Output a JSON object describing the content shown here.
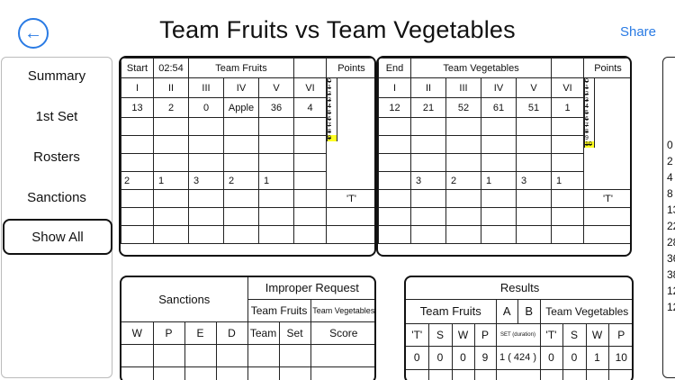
{
  "header": {
    "title": "Team Fruits vs  Team Vegetables",
    "share": "Share",
    "back_icon": "circle-arrow-left-icon"
  },
  "sidebar": {
    "items": [
      "Summary",
      "1st Set",
      "Rosters",
      "Sanctions",
      "Show All"
    ],
    "selected": "Show All"
  },
  "left_team": {
    "label": "Start",
    "time": "02:54",
    "name": "Team Fruits",
    "points_label": "Points",
    "positions": [
      "I",
      "II",
      "III",
      "IV",
      "V",
      "VI"
    ],
    "players": [
      "13",
      "2",
      "0",
      "Apple",
      "36",
      "4"
    ],
    "serve": [
      "2",
      "1",
      "3",
      "2",
      "1",
      ""
    ],
    "points": [
      "0",
      "1",
      "2",
      "3",
      "4",
      "5",
      "6",
      "7",
      "8",
      "9"
    ],
    "current_point": "9"
  },
  "right_team": {
    "label": "End",
    "name": "Team Vegetables",
    "points_label": "Points",
    "positions": [
      "I",
      "II",
      "III",
      "IV",
      "V",
      "VI"
    ],
    "players": [
      "12",
      "21",
      "52",
      "61",
      "51",
      "1"
    ],
    "serve": [
      "3",
      "2",
      "1",
      "3",
      "1",
      ""
    ],
    "points": [
      "0",
      "1",
      "2",
      "3",
      "4",
      "5",
      "6",
      "7",
      "8",
      "9",
      "10"
    ],
    "current_point": "10"
  },
  "timeout_marker": "'T'",
  "sanctions": {
    "title": "Sanctions",
    "cols": [
      "W",
      "P",
      "E",
      "D"
    ],
    "improper_title": "Improper Request",
    "team_a": "Team Fruits",
    "team_b": "Team Vegetables",
    "sub_cols": [
      "Team",
      "Set",
      "Score"
    ]
  },
  "results": {
    "title": "Results",
    "team_a": "Team Fruits",
    "a": "A",
    "b": "B",
    "team_b": "Team Vegetables",
    "cols_a": [
      "'T'",
      "S",
      "W",
      "P"
    ],
    "set_col": "SET",
    "duration_col": "(duration)",
    "cols_b": [
      "'T'",
      "S",
      "W",
      "P"
    ],
    "row_a": [
      "0",
      "0",
      "0",
      "9"
    ],
    "set_value": "1 ( 424 )",
    "row_b": [
      "0",
      "0",
      "1",
      "10"
    ]
  },
  "right_edge": [
    "0",
    "2",
    "4",
    "8",
    "13",
    "22",
    "28",
    "36",
    "38",
    "12",
    "12"
  ]
}
